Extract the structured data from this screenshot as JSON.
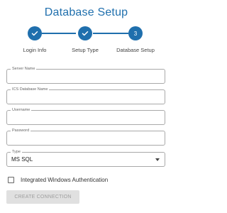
{
  "title": "Database Setup",
  "steps": [
    {
      "label": "Login Info",
      "state": "complete",
      "icon": "check-icon"
    },
    {
      "label": "Setup Type",
      "state": "complete",
      "icon": "check-icon"
    },
    {
      "label": "Database Setup",
      "state": "active",
      "number": "3"
    }
  ],
  "form": {
    "server_name": {
      "label": "Server Name",
      "value": ""
    },
    "ics_database_name": {
      "label": "ICS Database Name",
      "value": ""
    },
    "username": {
      "label": "Username",
      "value": ""
    },
    "password": {
      "label": "Password",
      "value": ""
    },
    "type": {
      "label": "Type",
      "value": "MS SQL"
    },
    "integrated_auth": {
      "label": "Integrated Windows Authentication",
      "checked": false
    }
  },
  "buttons": {
    "create_connection": "CREATE CONNECTION"
  },
  "colors": {
    "accent": "#1f6fad",
    "disabled_bg": "#e0e0e0",
    "disabled_text": "#9e9e9e"
  }
}
